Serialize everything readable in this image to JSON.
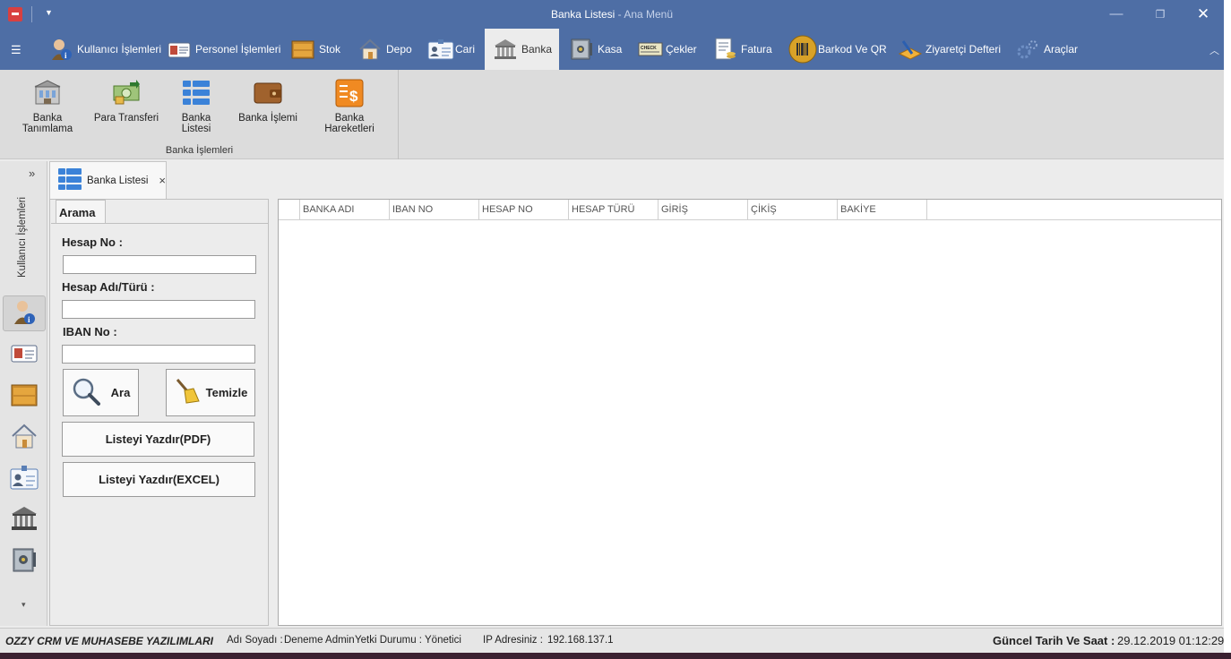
{
  "window": {
    "title": "Banka Listesi",
    "app_name": " - Ana Menü",
    "minimize": "—",
    "maximize": "❐",
    "close": "✕"
  },
  "ribbon": {
    "tabs": [
      {
        "label": "Kullanıcı İşlemleri",
        "icon": "user-info-icon"
      },
      {
        "label": "Personel İşlemleri",
        "icon": "id-card-icon"
      },
      {
        "label": "Stok",
        "icon": "crate-icon"
      },
      {
        "label": "Depo",
        "icon": "house-icon"
      },
      {
        "label": "Cari",
        "icon": "badge-icon"
      },
      {
        "label": "Banka",
        "icon": "bank-icon"
      },
      {
        "label": "Kasa",
        "icon": "safe-icon"
      },
      {
        "label": "Çekler",
        "icon": "check-icon"
      },
      {
        "label": "Fatura",
        "icon": "invoice-icon"
      },
      {
        "label": "Barkod Ve QR",
        "icon": "barcode-icon"
      },
      {
        "label": "Ziyaretçi Defteri",
        "icon": "guestbook-icon"
      },
      {
        "label": "Araçlar",
        "icon": "gears-icon"
      }
    ],
    "active_tab": "Banka",
    "group": {
      "label": "Banka İşlemleri",
      "buttons": [
        {
          "label": "Banka Tanımlama",
          "icon": "bank-building-icon"
        },
        {
          "label": "Para Transferi",
          "icon": "money-transfer-icon"
        },
        {
          "label": "Banka Listesi",
          "icon": "list-grid-icon"
        },
        {
          "label": "Banka İşlemi",
          "icon": "wallet-icon"
        },
        {
          "label": "Banka Hareketleri",
          "icon": "dollar-doc-icon"
        }
      ]
    }
  },
  "nav": {
    "expand": "»",
    "group_label": "Kullanıcı İşlemleri",
    "more": "▾"
  },
  "document_tab": {
    "label": "Banka Listesi",
    "close": "×"
  },
  "search": {
    "tab_label": "Arama",
    "hesap_no_label": "Hesap No :",
    "hesap_adi_label": "Hesap Adı/Türü :",
    "iban_label": "IBAN No :",
    "hesap_no_value": "",
    "hesap_adi_value": "",
    "iban_value": "",
    "search_button": "Ara",
    "clear_button": "Temizle",
    "print_pdf": "Listeyi Yazdır(PDF)",
    "print_excel": "Listeyi Yazdır(EXCEL)"
  },
  "grid": {
    "columns": [
      "BANKA ADI",
      "IBAN NO",
      "HESAP NO",
      "HESAP TÜRÜ",
      "GİRİŞ",
      "ÇİKİŞ",
      "BAKİYE"
    ],
    "rows": []
  },
  "status": {
    "company": "OZZY CRM VE MUHASEBE YAZILIMLARI",
    "name_label": "Adı Soyadı :",
    "name_value": "Deneme Admin",
    "role_label": "Yetki Durumu :",
    "role_value": "Yönetici",
    "ip_label": "IP Adresiniz :",
    "ip_value": "192.168.137.1",
    "datetime_label": "Güncel Tarih Ve Saat :",
    "datetime_value": "29.12.2019 01:12:29"
  },
  "colors": {
    "ribbon_blue": "#4e6ea5",
    "ribbon_page": "#dcdcdc",
    "icon_blue": "#3b82d8",
    "icon_orange": "#f08a22",
    "icon_brown": "#a0622d"
  }
}
